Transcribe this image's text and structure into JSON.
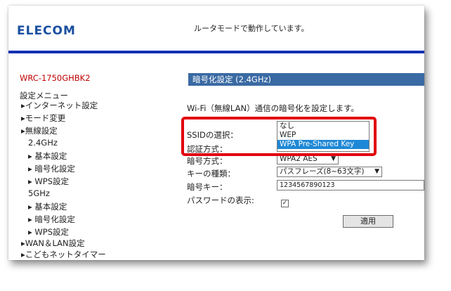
{
  "header": {
    "logo": "ELECOM",
    "mode_status": "ルータモードで動作しています。",
    "accent_color": "#1432b4"
  },
  "sidebar": {
    "model": "WRC-1750GHBK2",
    "menu_title": "設定メニュー",
    "items": [
      "▸インターネット設定",
      "▸モード変更",
      "▸無線設定",
      "2.4GHz",
      "▸ 基本設定",
      "▸ 暗号化設定",
      "▸ WPS設定",
      "5GHz",
      "▸ 基本設定",
      "▸ 暗号化設定",
      "▸ WPS設定",
      "▸WAN＆LAN設定",
      "▸こどもネットタイマー"
    ]
  },
  "main": {
    "section_title": "暗号化設定 (2.4GHz)",
    "description": "Wi-Fi（無線LAN）通信の暗号化を設定します。",
    "fields": {
      "ssid_label": "SSIDの選択：",
      "auth_label": "認証方式：",
      "cipher_label": "暗号方式：",
      "cipher_value": "WPA2 AES",
      "key_type_label": "キーの種類：",
      "key_type_value": "パスフレーズ(8~63文字)",
      "key_label": "暗号キー：",
      "key_value": "1234567890123",
      "show_password_label": "パスワードの表示:",
      "show_password_checked": "✓"
    },
    "auth_dropdown_options": [
      "なし",
      "WEP",
      "WPA Pre-Shared Key"
    ],
    "auth_dropdown_selected": "WPA Pre-Shared Key",
    "apply_label": "適用",
    "highlight_color": "#e3000b"
  }
}
